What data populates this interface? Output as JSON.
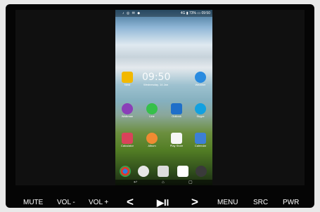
{
  "phone": {
    "status": {
      "left_icons": "♪ ◎ ✉ ◆",
      "right_text": "4G ▮ 73% ▭ 09:50"
    },
    "clock": "09:50",
    "clock_date": "Wednesday, 14 Jan",
    "apps": [
      {
        "label": "Nest",
        "icon": "note-icon",
        "color": "#f2b800"
      },
      {
        "label": "Weather",
        "icon": "weather-icon",
        "color": "#2a8be0"
      },
      {
        "label": "Walkman",
        "icon": "walkman-icon",
        "color": "#8a3fb8"
      },
      {
        "label": "Line",
        "icon": "line-chat-icon",
        "color": "#36c04a"
      },
      {
        "label": "Outlook",
        "icon": "outlook-icon",
        "color": "#1f6fc9"
      },
      {
        "label": "Skype",
        "icon": "skype-icon",
        "color": "#12a0e0"
      },
      {
        "label": "Calculator",
        "icon": "calculator-icon",
        "color": "#d9435a"
      },
      {
        "label": "Album",
        "icon": "album-icon",
        "color": "#f08b32"
      },
      {
        "label": "Play Store",
        "icon": "play-store-icon",
        "color": "#f6f6f6"
      },
      {
        "label": "Calendar",
        "icon": "calendar-icon",
        "color": "#3d7fd6"
      }
    ],
    "dock": [
      "chrome-icon",
      "clock-icon",
      "apps-grid-icon",
      "phone-book-icon",
      "phone-icon"
    ],
    "navbar": {
      "back": "↩",
      "home": "⌂",
      "recents": "▢"
    }
  },
  "controls": {
    "mute": "MUTE",
    "vol_down": "VOL -",
    "vol_up": "VOL +",
    "prev": "<",
    "play_pause": "▶II",
    "next": ">",
    "menu": "MENU",
    "src": "SRC",
    "pwr": "PWR"
  }
}
